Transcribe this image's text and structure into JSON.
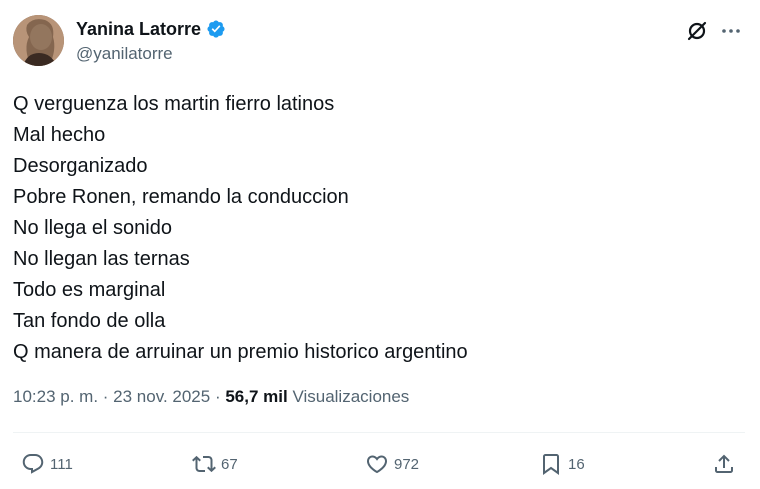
{
  "author": {
    "display_name": "Yanina Latorre",
    "handle": "@yanilatorre",
    "verified": true,
    "verified_color": "#1d9bf0"
  },
  "tweet": {
    "lines": [
      "Q verguenza los martin fierro latinos",
      "Mal hecho",
      "Desorganizado",
      "Pobre Ronen, remando la conduccion",
      "No llega el sonido",
      "No llegan las ternas",
      "Todo es marginal",
      "Tan fondo de olla",
      "Q manera de arruinar un premio historico argentino"
    ]
  },
  "meta": {
    "time": "10:23 p. m.",
    "separator": " · ",
    "date": "23 nov. 2025",
    "views_count": "56,7 mil",
    "views_label": "Visualizaciones"
  },
  "actions": {
    "replies": "111",
    "retweets": "67",
    "likes": "972",
    "bookmarks": "16"
  },
  "icons": {
    "grok": "grok-icon",
    "more": "more-icon",
    "reply": "reply-icon",
    "retweet": "retweet-icon",
    "like": "heart-icon",
    "bookmark": "bookmark-icon",
    "share": "share-icon"
  },
  "colors": {
    "text_primary": "#0f1419",
    "text_secondary": "#536471",
    "divider": "#eff3f4"
  }
}
